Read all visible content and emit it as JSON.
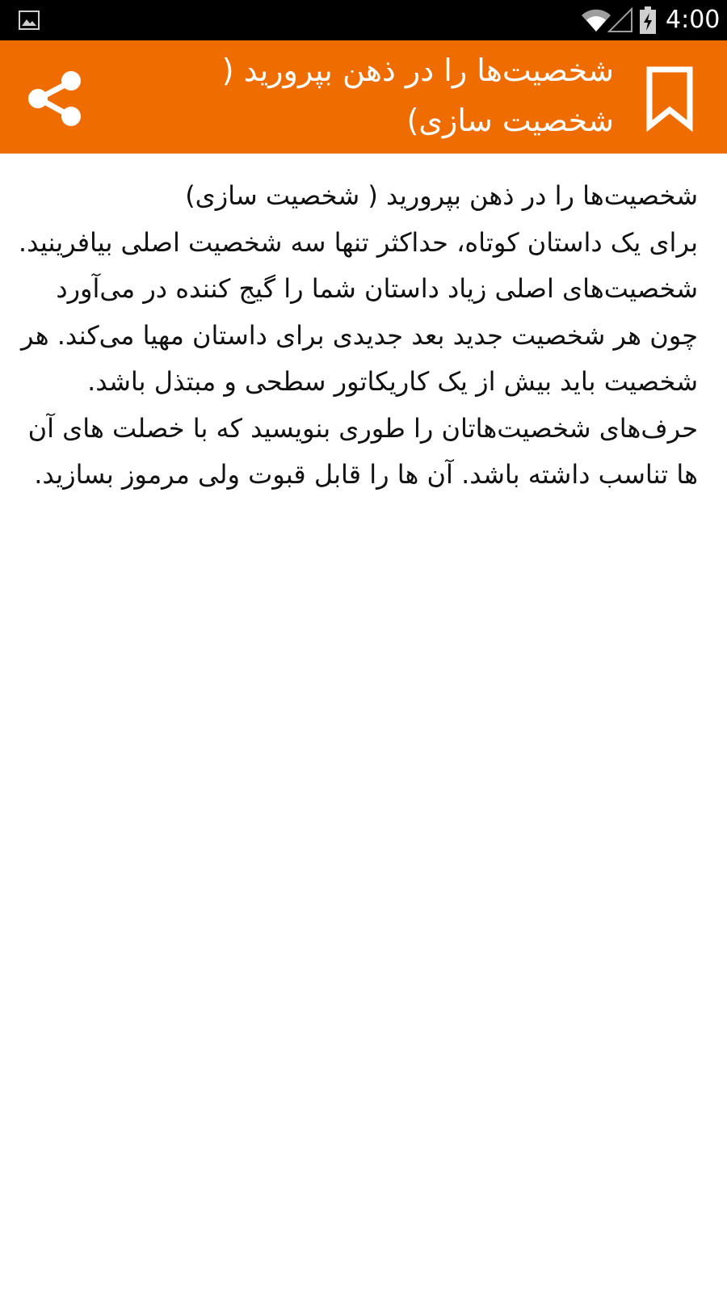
{
  "status_bar": {
    "time": "4:00",
    "icons": [
      "image-notification-icon",
      "wifi-icon",
      "signal-icon",
      "battery-charging-icon"
    ]
  },
  "app_bar": {
    "title": "شخصیت‌ها را در ذهن بپرورید ( شخصیت سازی)",
    "share_icon": "share-icon",
    "bookmark_icon": "bookmark-icon",
    "color": "#ef6c00"
  },
  "article": {
    "heading": "شخصیت‌ها را در ذهن بپرورید ( شخصیت سازی)",
    "body": "برای یک داستان کوتاه، حداکثر تنها سه شخصیت اصلی بیافرینید. شخصیت‌های اصلی زیاد داستان شما را گیج کننده در می‌آورد چون هر شخصیت جدید بعد جدیدی برای داستان مهیا می‌کند. هر شخصیت باید بیش از یک کاریکاتور سطحی و مبتذل باشد. حرف‌های شخصیت‌هاتان را طوری بنویسید که با خصلت های آن ها تناسب داشته باشد. آن ها را قابل قبوت ولی مرموز بسازید."
  }
}
